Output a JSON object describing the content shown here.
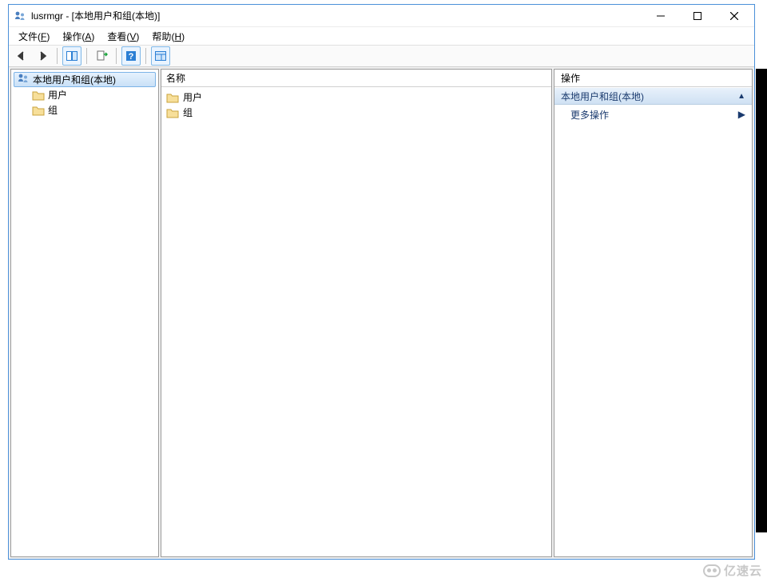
{
  "title": "lusrmgr - [本地用户和组(本地)]",
  "menus": {
    "file": {
      "label": "文件",
      "accel": "F"
    },
    "action": {
      "label": "操作",
      "accel": "A"
    },
    "view": {
      "label": "查看",
      "accel": "V"
    },
    "help": {
      "label": "帮助",
      "accel": "H"
    }
  },
  "tree": {
    "root": "本地用户和组(本地)",
    "users": "用户",
    "groups": "组"
  },
  "list": {
    "header_name": "名称",
    "users": "用户",
    "groups": "组"
  },
  "actions": {
    "title": "操作",
    "band": "本地用户和组(本地)",
    "more": "更多操作"
  },
  "watermark": "亿速云"
}
